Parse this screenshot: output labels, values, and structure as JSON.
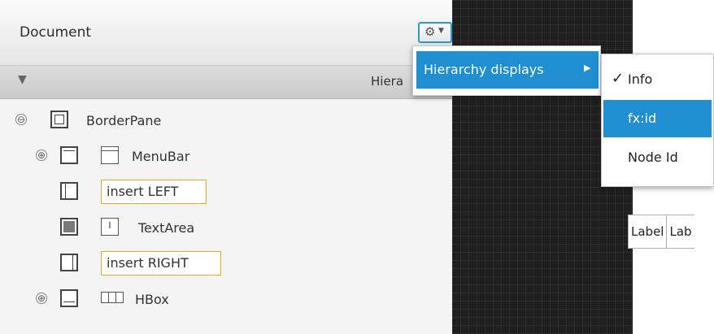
{
  "panel": {
    "title": "Document",
    "settings_icon": "gear-icon",
    "settings_caret": "chevron-down-icon"
  },
  "column_header": {
    "collapse_icon": "triangle-down-icon",
    "label": "Hiera"
  },
  "tree": {
    "root": {
      "label": "BorderPane",
      "expander": "⊖"
    },
    "menubar": {
      "label": "MenuBar",
      "expander": "⊕"
    },
    "insert_left": {
      "label": "insert LEFT"
    },
    "textarea": {
      "label": "TextArea",
      "icon_text": "I"
    },
    "insert_right": {
      "label": "insert RIGHT"
    },
    "hbox": {
      "label": "HBox",
      "expander": "⊕"
    }
  },
  "context_menu": {
    "item_label": "Hierarchy displays",
    "submenu_arrow": "▶"
  },
  "submenu": {
    "items": [
      {
        "label": "Info",
        "checked": true
      },
      {
        "label": "fx:id",
        "selected": true
      },
      {
        "label": "Node Id"
      }
    ],
    "check_mark": "✓"
  },
  "canvas": {
    "cells": [
      "Label",
      "Lab"
    ]
  },
  "colors": {
    "accent": "#1f8fd1",
    "insert_border": "#f5a623",
    "canvas_bg": "#1f1f1f"
  }
}
